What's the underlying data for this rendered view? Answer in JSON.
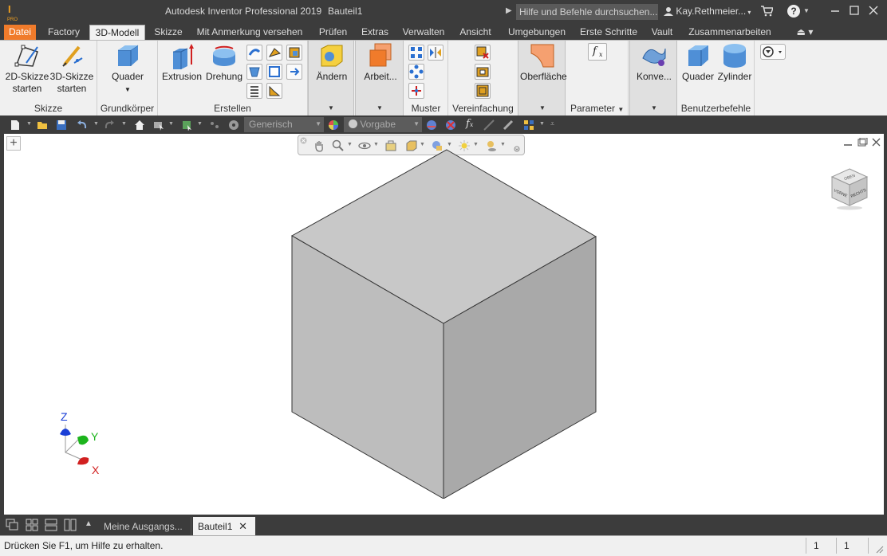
{
  "app": {
    "title": "Autodesk Inventor Professional 2019",
    "document": "Bauteil1",
    "logo_letter": "I",
    "logo_sub": "PRO",
    "search_placeholder": "Hilfe und Befehle durchsuchen...",
    "user": "Kay.Rethmeier...",
    "help": "?"
  },
  "tabs": [
    {
      "label": "Datei"
    },
    {
      "label": "Factory"
    },
    {
      "label": "3D-Modell"
    },
    {
      "label": "Skizze"
    },
    {
      "label": "Mit Anmerkung versehen"
    },
    {
      "label": "Prüfen"
    },
    {
      "label": "Extras"
    },
    {
      "label": "Verwalten"
    },
    {
      "label": "Ansicht"
    },
    {
      "label": "Umgebungen"
    },
    {
      "label": "Erste Schritte"
    },
    {
      "label": "Vault"
    },
    {
      "label": "Zusammenarbeiten"
    }
  ],
  "ribbon": {
    "skizze": {
      "label": "Skizze",
      "btn2d_line1": "2D-Skizze",
      "btn2d_line2": "starten",
      "btn3d_line1": "3D-Skizze",
      "btn3d_line2": "starten"
    },
    "grundkoerper": {
      "label": "Grundkörper",
      "quader": "Quader"
    },
    "erstellen": {
      "label": "Erstellen",
      "extrusion": "Extrusion",
      "drehung": "Drehung"
    },
    "aendern": {
      "label": "Ändern"
    },
    "arbeit": {
      "label": "Arbeit..."
    },
    "muster": {
      "label": "Muster"
    },
    "vereinfachung": {
      "label": "Vereinfachung"
    },
    "oberflaeche": {
      "label": "Oberfläche"
    },
    "parameter": {
      "label": "Parameter",
      "fx": "f"
    },
    "konvertieren": {
      "label": "Konve..."
    },
    "benutzer": {
      "label": "Benutzerbefehle",
      "quader": "Quader",
      "zylinder": "Zylinder"
    }
  },
  "qat": {
    "material": "Generisch",
    "appearance": "Vorgabe",
    "fx": "f"
  },
  "viewport": {
    "plus": "+",
    "triad": {
      "z": "Z",
      "y": "Y",
      "x": "X"
    },
    "viewcube": {
      "top": "OBEN",
      "front": "VORNE",
      "right": "RECHTS"
    },
    "colors": {
      "cube_top": "#c8c8c8",
      "cube_left": "#bdbdbd",
      "cube_right": "#a9a9a9",
      "axis_x": "#d12020",
      "axis_y": "#1cb41c",
      "axis_z": "#1a3fd6"
    }
  },
  "doctabs": {
    "home": "Meine Ausgangs...",
    "active": "Bauteil1",
    "close": "✕"
  },
  "status": {
    "text": "Drücken Sie F1, um Hilfe zu erhalten.",
    "n1": "1",
    "n2": "1"
  }
}
